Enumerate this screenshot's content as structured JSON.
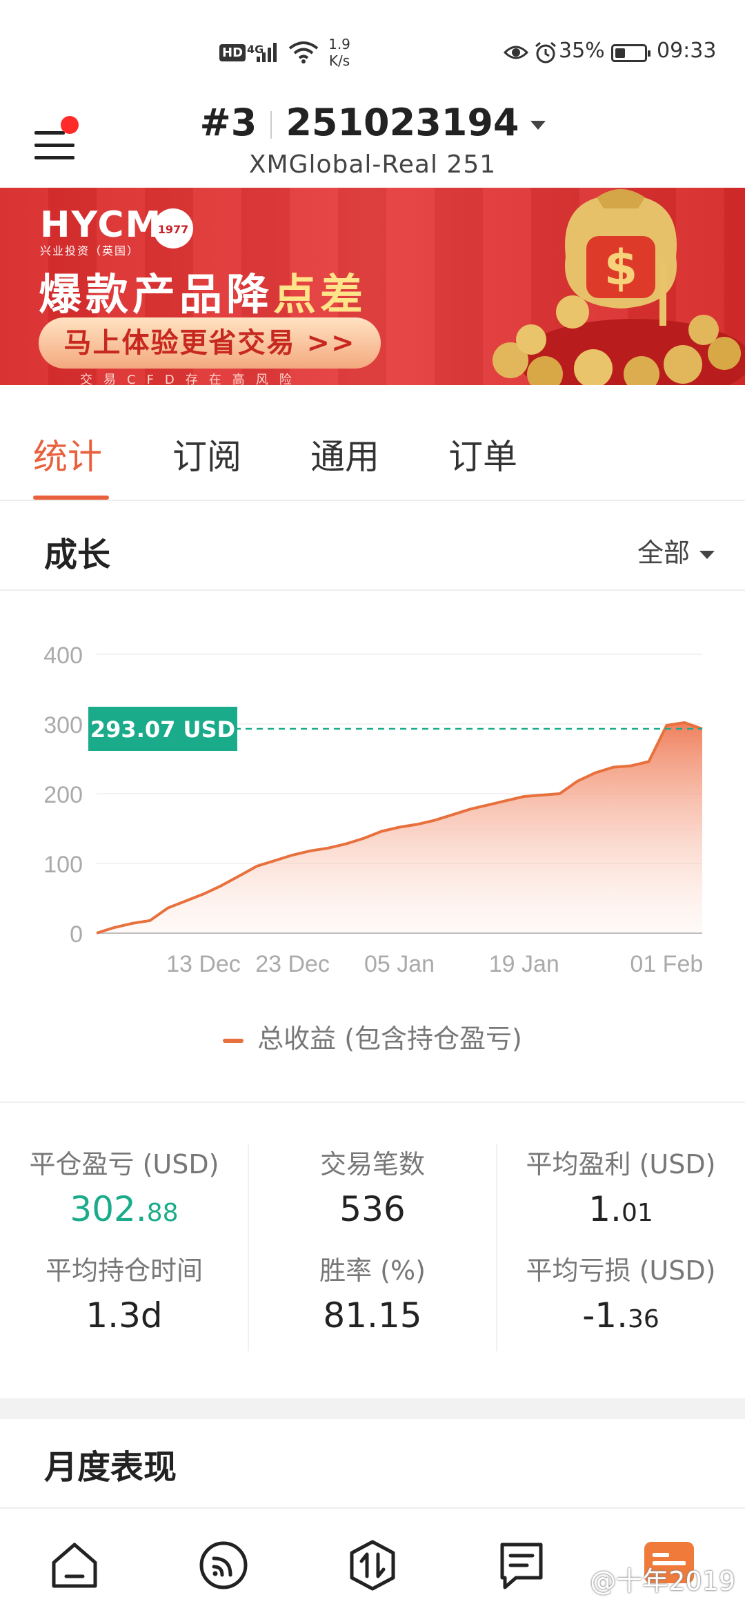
{
  "status_bar": {
    "hd": "HD",
    "net": "4G",
    "speed_value": "1.9",
    "speed_unit": "K/s",
    "battery_pct": "35%",
    "battery_level": 0.35,
    "time": "09:33",
    "icons": [
      "signal-icon",
      "wifi-icon",
      "eye-icon",
      "alarm-icon",
      "battery-icon"
    ]
  },
  "header": {
    "account_prefix": "#3",
    "account_number": "251023194",
    "server": "XMGlobal-Real 251",
    "menu_badge_color": "#ff2a2a"
  },
  "banner": {
    "logo": "HYCM",
    "logo_sub": "兴业投资（英国）",
    "seal": "1977",
    "headline_main": "爆款产品降",
    "headline_highlight": "点差",
    "cta": "马上体验更省交易 >>",
    "risk_note": "交易CFD存在高风险"
  },
  "tabs": [
    {
      "label": "统计",
      "active": true
    },
    {
      "label": "订阅",
      "active": false
    },
    {
      "label": "通用",
      "active": false
    },
    {
      "label": "订单",
      "active": false
    }
  ],
  "growth": {
    "title": "成长",
    "range_label": "全部"
  },
  "chart_data": {
    "type": "area",
    "title": "",
    "xlabel": "",
    "ylabel": "",
    "ylim": [
      0,
      400
    ],
    "yticks": [
      "400",
      "300",
      "200",
      "100",
      "0"
    ],
    "xticks": [
      "13 Dec",
      "23 Dec",
      "05 Jan",
      "19 Jan",
      "01 Feb"
    ],
    "grid": true,
    "legend_position": "bottom",
    "current_value_label": "293.07 USD",
    "current_value": 293.07,
    "series": [
      {
        "name": "总收益 (包含持仓盈亏)",
        "color": "#e8703c",
        "x": [
          "30 Nov",
          "03 Dec",
          "05 Dec",
          "07 Dec",
          "09 Dec",
          "11 Dec",
          "13 Dec",
          "15 Dec",
          "17 Dec",
          "19 Dec",
          "21 Dec",
          "23 Dec",
          "25 Dec",
          "27 Dec",
          "29 Dec",
          "31 Dec",
          "02 Jan",
          "04 Jan",
          "06 Jan",
          "08 Jan",
          "10 Jan",
          "12 Jan",
          "14 Jan",
          "16 Jan",
          "18 Jan",
          "20 Jan",
          "22 Jan",
          "24 Jan",
          "26 Jan",
          "28 Jan",
          "30 Jan",
          "31 Jan",
          "01 Feb",
          "03 Feb",
          "05 Feb"
        ],
        "values": [
          0,
          8,
          14,
          18,
          36,
          46,
          56,
          68,
          82,
          96,
          104,
          112,
          118,
          122,
          128,
          136,
          146,
          152,
          156,
          162,
          170,
          178,
          184,
          190,
          196,
          198,
          200,
          218,
          230,
          238,
          240,
          246,
          298,
          302,
          293
        ]
      }
    ]
  },
  "stats": [
    {
      "label": "平仓盈亏 (USD)",
      "int": "302.",
      "frac": "88",
      "accent": true
    },
    {
      "label": "交易笔数",
      "int": "536",
      "frac": "",
      "accent": false
    },
    {
      "label": "平均盈利 (USD)",
      "int": "1.",
      "frac": "01",
      "accent": false
    },
    {
      "label": "平均持仓时间",
      "int": "1.3d",
      "frac": "",
      "accent": false
    },
    {
      "label": "胜率 (%)",
      "int": "81.15",
      "frac": "",
      "accent": false
    },
    {
      "label": "平均亏损 (USD)",
      "int": "-1.",
      "frac": "36",
      "accent": false
    }
  ],
  "monthly": {
    "title": "月度表现"
  },
  "bottom_nav": {
    "items": [
      "home-icon",
      "signals-icon",
      "trade-icon",
      "orders-icon",
      "stats-icon"
    ],
    "active_color": "#f07a3a"
  },
  "watermark": "@十年2019",
  "colors": {
    "accent": "#e8603c",
    "positive": "#1aab8a"
  }
}
